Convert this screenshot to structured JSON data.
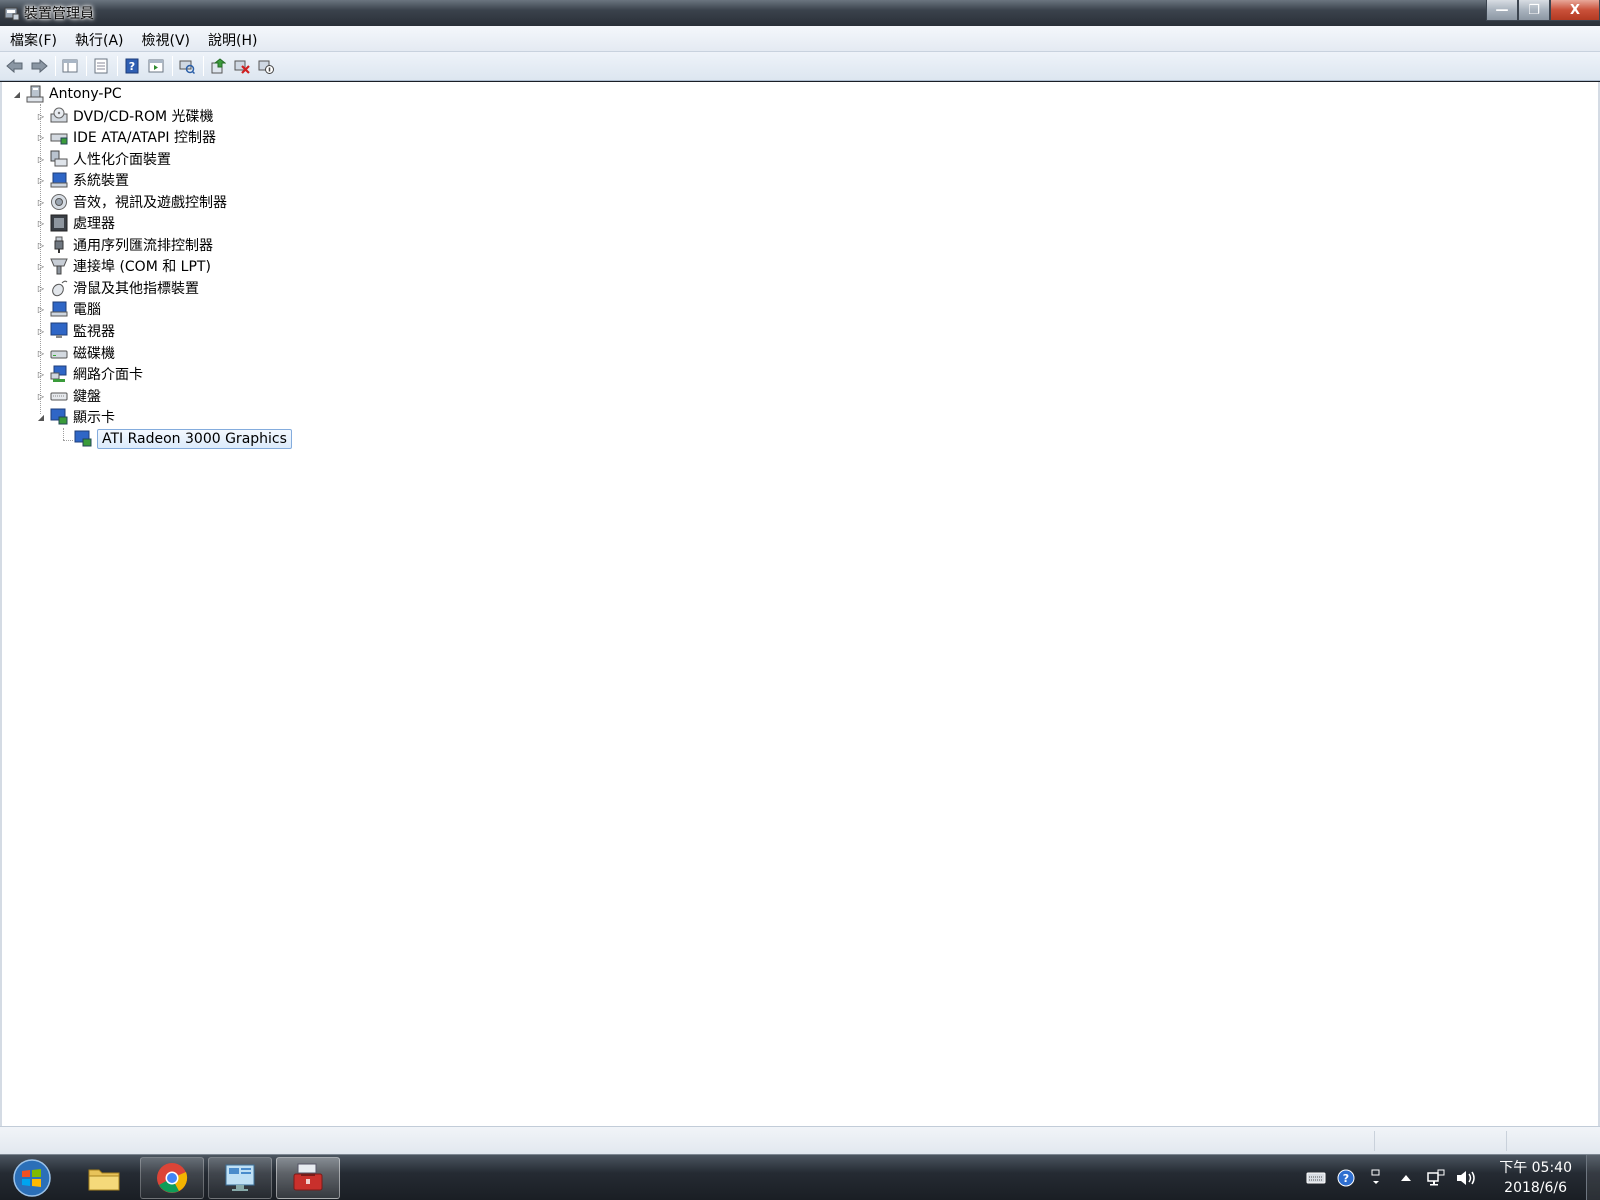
{
  "window": {
    "title": "裝置管理員",
    "controls": {
      "minimize": "—",
      "maximize": "❐",
      "close": "X"
    }
  },
  "menu": {
    "items": [
      "檔案(F)",
      "執行(A)",
      "檢視(V)",
      "說明(H)"
    ]
  },
  "toolbar": {
    "buttons": [
      "back-icon",
      "forward-icon",
      "show-hide-tree-icon",
      "properties-icon",
      "help-icon",
      "action-pane-icon",
      "scan-hardware-icon",
      "update-driver-icon",
      "uninstall-icon",
      "disable-icon"
    ]
  },
  "tree": {
    "root": {
      "label": "Antony-PC",
      "expanded": true
    },
    "categories": [
      {
        "label": "DVD/CD-ROM 光碟機",
        "icon": "optical-drive-icon",
        "expanded": false
      },
      {
        "label": "IDE ATA/ATAPI 控制器",
        "icon": "ide-controller-icon",
        "expanded": false
      },
      {
        "label": "人性化介面裝置",
        "icon": "hid-icon",
        "expanded": false
      },
      {
        "label": "系統裝置",
        "icon": "system-devices-icon",
        "expanded": false
      },
      {
        "label": "音效，視訊及遊戲控制器",
        "icon": "sound-icon",
        "expanded": false
      },
      {
        "label": "處理器",
        "icon": "processor-icon",
        "expanded": false
      },
      {
        "label": "通用序列匯流排控制器",
        "icon": "usb-icon",
        "expanded": false
      },
      {
        "label": "連接埠 (COM 和 LPT)",
        "icon": "ports-icon",
        "expanded": false
      },
      {
        "label": "滑鼠及其他指標裝置",
        "icon": "mouse-icon",
        "expanded": false
      },
      {
        "label": "電腦",
        "icon": "computer-icon",
        "expanded": false
      },
      {
        "label": "監視器",
        "icon": "monitor-icon",
        "expanded": false
      },
      {
        "label": "磁碟機",
        "icon": "disk-drive-icon",
        "expanded": false
      },
      {
        "label": "網路介面卡",
        "icon": "network-adapter-icon",
        "expanded": false
      },
      {
        "label": "鍵盤",
        "icon": "keyboard-icon",
        "expanded": false
      },
      {
        "label": "顯示卡",
        "icon": "display-adapter-icon",
        "expanded": true
      }
    ],
    "children": [
      {
        "label": "ATI Radeon 3000 Graphics",
        "icon": "display-adapter-icon",
        "selected": true
      }
    ]
  },
  "taskbar": {
    "buttons": [
      "windows-explorer-icon",
      "chrome-icon",
      "control-panel-icon",
      "device-manager-icon"
    ],
    "tray": {
      "icons": [
        "keyboard-tray-icon",
        "help-tray-icon",
        "language-icon",
        "show-hidden-icons",
        "network-icon",
        "volume-icon"
      ]
    },
    "clock": {
      "time": "下午 05:40",
      "date": "2018/6/6"
    }
  },
  "colors": {
    "selection_border": "#84acdd",
    "selection_fill": "#dcebfb",
    "menubar": "#e4eaf2",
    "taskbar": "#1a1e24"
  }
}
